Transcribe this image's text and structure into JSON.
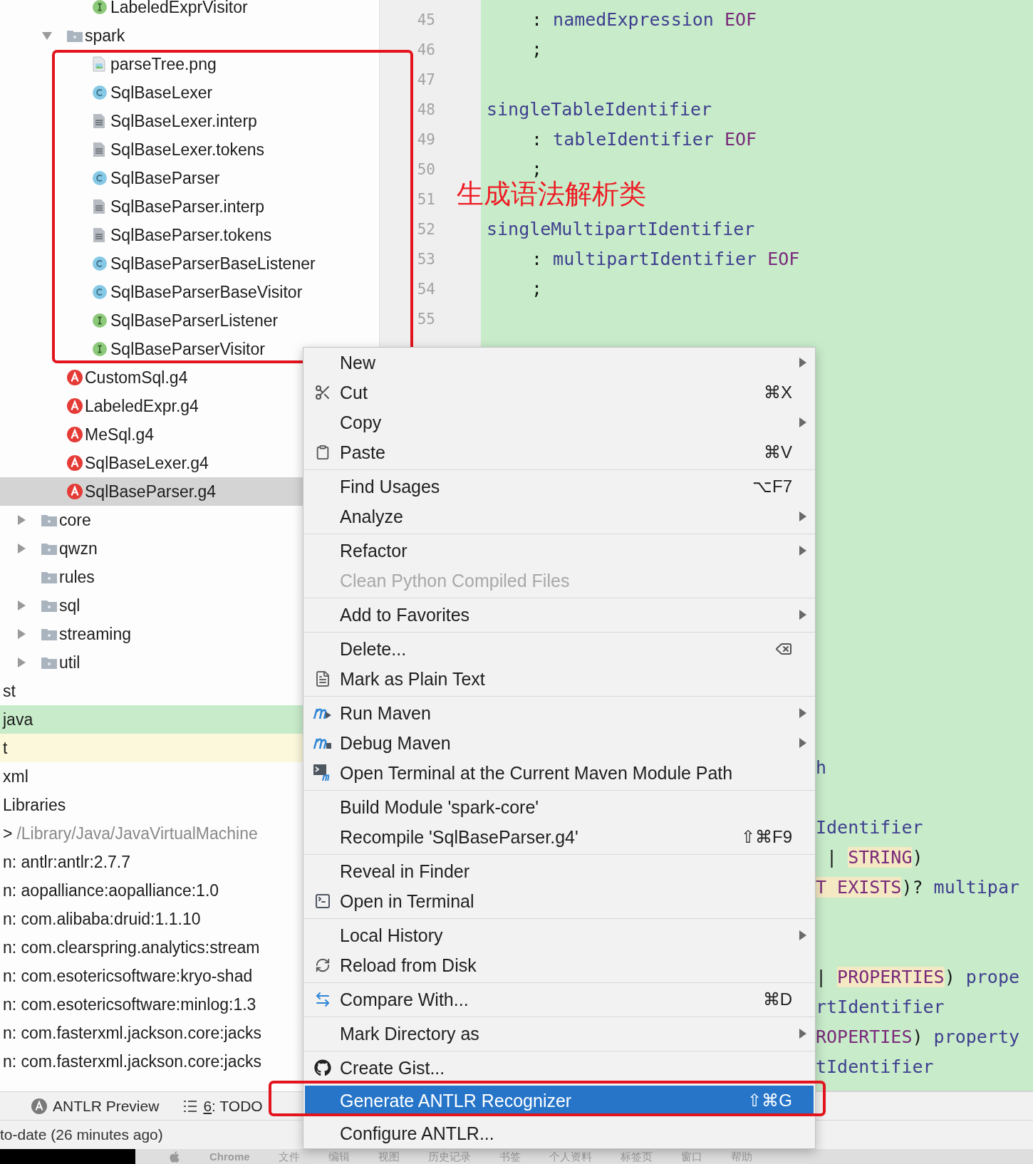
{
  "project_tree": [
    {
      "children": [
        {
          "children": [
            {
              "children": [
                {
                  "children": [
                    {
                      "label": "LabeledExprVisitor",
                      "kind": "interface",
                      "selected": false
                    }
                  ]
                },
                {
                  "label": "spark",
                  "kind": "folder",
                  "expanded": true,
                  "selected": false,
                  "children": [
                    {
                      "label": "parseTree.png",
                      "kind": "image",
                      "selected": false
                    },
                    {
                      "label": "SqlBaseLexer",
                      "kind": "class",
                      "selected": false
                    },
                    {
                      "label": "SqlBaseLexer.interp",
                      "kind": "file",
                      "selected": false
                    },
                    {
                      "label": "SqlBaseLexer.tokens",
                      "kind": "file",
                      "selected": false
                    },
                    {
                      "label": "SqlBaseParser",
                      "kind": "class",
                      "selected": false
                    },
                    {
                      "label": "SqlBaseParser.interp",
                      "kind": "file",
                      "selected": false
                    },
                    {
                      "label": "SqlBaseParser.tokens",
                      "kind": "file",
                      "selected": false
                    },
                    {
                      "label": "SqlBaseParserBaseListener",
                      "kind": "class",
                      "selected": false
                    },
                    {
                      "label": "SqlBaseParserBaseVisitor",
                      "kind": "class",
                      "selected": false
                    },
                    {
                      "label": "SqlBaseParserListener",
                      "kind": "interface",
                      "selected": false
                    },
                    {
                      "label": "SqlBaseParserVisitor",
                      "kind": "interface",
                      "selected": false
                    }
                  ]
                },
                {
                  "label": "CustomSql.g4",
                  "kind": "antlr",
                  "selected": false
                },
                {
                  "label": "LabeledExpr.g4",
                  "kind": "antlr",
                  "selected": false
                },
                {
                  "label": "MeSql.g4",
                  "kind": "antlr",
                  "selected": false
                },
                {
                  "label": "SqlBaseLexer.g4",
                  "kind": "antlr",
                  "selected": false
                },
                {
                  "label": "SqlBaseParser.g4",
                  "kind": "antlr",
                  "selected": true
                }
              ]
            },
            {
              "label": "core",
              "kind": "folder",
              "expanded": false,
              "selected": false
            },
            {
              "label": "qwzn",
              "kind": "folder",
              "expanded": false,
              "selected": false
            },
            {
              "label": "rules",
              "kind": "folder",
              "selected": false
            },
            {
              "label": "sql",
              "kind": "folder",
              "expanded": false,
              "selected": false
            },
            {
              "label": "streaming",
              "kind": "folder",
              "expanded": false,
              "selected": false
            },
            {
              "label": "util",
              "kind": "folder",
              "expanded": false,
              "selected": false
            }
          ]
        }
      ]
    },
    {
      "label": "st",
      "kind": "plain",
      "selected": false
    },
    {
      "label": "java",
      "kind": "plain",
      "color": "#c8ecca",
      "selected": false
    },
    {
      "label": "t",
      "kind": "plain",
      "color": "#fbf8dc",
      "selected": false
    },
    {
      "label": "xml",
      "kind": "plain",
      "selected": false
    },
    {
      "label": "Libraries",
      "kind": "plain",
      "selected": false
    },
    {
      "label": ">",
      "detail": "/Library/Java/JavaVirtualMachine",
      "kind": "plain",
      "selected": false
    },
    {
      "label": "n: antlr:antlr:2.7.7",
      "kind": "plain",
      "selected": false
    },
    {
      "label": "n: aopalliance:aopalliance:1.0",
      "kind": "plain",
      "selected": false
    },
    {
      "label": "n: com.alibaba:druid:1.1.10",
      "kind": "plain",
      "selected": false
    },
    {
      "label": "n: com.clearspring.analytics:stream",
      "kind": "plain",
      "selected": false
    },
    {
      "label": "n: com.esotericsoftware:kryo-shad",
      "kind": "plain",
      "selected": false
    },
    {
      "label": "n: com.esotericsoftware:minlog:1.3",
      "kind": "plain",
      "selected": false
    },
    {
      "label": "n: com.fasterxml.jackson.core:jacks",
      "kind": "plain",
      "selected": false
    },
    {
      "label": "n: com.fasterxml.jackson.core:jacks",
      "kind": "plain",
      "selected": false
    }
  ],
  "gutter": {
    "line_numbers": [
      "45",
      "46",
      "47",
      "48",
      "49",
      "50",
      "51",
      "52",
      "53",
      "54",
      "55"
    ]
  },
  "editor": {
    "lines": [
      {
        "kind": "code",
        "indent": true,
        "tokens": [
          {
            "text": ": ",
            "kind": "punct"
          },
          {
            "text": "namedExpression",
            "kind": "rule"
          },
          {
            "text": " EOF",
            "kind": "token"
          }
        ]
      },
      {
        "kind": "code",
        "indent": true,
        "tokens": [
          {
            "text": ";",
            "kind": "punct"
          }
        ]
      },
      {
        "kind": "blank"
      },
      {
        "kind": "code",
        "indent": false,
        "tokens": [
          {
            "text": "singleTableIdentifier",
            "kind": "rule"
          }
        ]
      },
      {
        "kind": "code",
        "indent": true,
        "tokens": [
          {
            "text": ": ",
            "kind": "punct"
          },
          {
            "text": "tableIdentifier",
            "kind": "rule"
          },
          {
            "text": " EOF",
            "kind": "token"
          }
        ]
      },
      {
        "kind": "code",
        "indent": true,
        "tokens": [
          {
            "text": ";",
            "kind": "punct"
          }
        ]
      },
      {
        "kind": "blank"
      },
      {
        "kind": "code",
        "indent": false,
        "tokens": [
          {
            "text": "singleMultipartIdentifier",
            "kind": "rule"
          }
        ]
      },
      {
        "kind": "code",
        "indent": true,
        "tokens": [
          {
            "text": ": ",
            "kind": "punct"
          },
          {
            "text": "multipartIdentifier",
            "kind": "rule"
          },
          {
            "text": " EOF",
            "kind": "token"
          }
        ]
      },
      {
        "kind": "code",
        "indent": true,
        "tokens": [
          {
            "text": ";",
            "kind": "punct"
          }
        ]
      },
      {
        "kind": "blank"
      },
      {
        "kind": "blank"
      },
      {
        "kind": "blank"
      },
      {
        "kind": "blank"
      },
      {
        "kind": "blank"
      },
      {
        "kind": "blank"
      },
      {
        "kind": "blank"
      },
      {
        "kind": "blank"
      },
      {
        "kind": "blank"
      },
      {
        "kind": "blank"
      },
      {
        "kind": "blank"
      },
      {
        "kind": "blank"
      },
      {
        "kind": "blank"
      },
      {
        "kind": "blank"
      },
      {
        "kind": "blank"
      },
      {
        "kind": "fragment",
        "tokens": [
          {
            "text": "h",
            "kind": "rule"
          }
        ]
      },
      {
        "kind": "blank"
      },
      {
        "kind": "fragment",
        "tokens": [
          {
            "text": "Identifier",
            "kind": "rule"
          }
        ]
      },
      {
        "kind": "fragment",
        "tokens": [
          {
            "text": " | ",
            "kind": "punct"
          },
          {
            "text": "STRING",
            "kind": "literal"
          },
          {
            "text": ")",
            "kind": "punct"
          }
        ]
      },
      {
        "kind": "fragment",
        "tokens": [
          {
            "text": "T EXISTS",
            "kind": "literal"
          },
          {
            "text": ")? ",
            "kind": "punct"
          },
          {
            "text": "multipar",
            "kind": "rule"
          }
        ]
      },
      {
        "kind": "blank"
      },
      {
        "kind": "blank"
      },
      {
        "kind": "fragment",
        "tokens": [
          {
            "text": "| ",
            "kind": "punct"
          },
          {
            "text": "PROPERTIES",
            "kind": "literal"
          },
          {
            "text": ") ",
            "kind": "punct"
          },
          {
            "text": "prope",
            "kind": "rule"
          }
        ]
      },
      {
        "kind": "fragment",
        "tokens": [
          {
            "text": "rtIdentifier",
            "kind": "rule"
          }
        ]
      },
      {
        "kind": "fragment",
        "tokens": [
          {
            "text": "ROPERTIES",
            "kind": "token"
          },
          {
            "text": ") ",
            "kind": "punct"
          },
          {
            "text": "property",
            "kind": "rule"
          }
        ]
      },
      {
        "kind": "fragment",
        "tokens": [
          {
            "text": "tIdentifier",
            "kind": "rule"
          }
        ]
      }
    ]
  },
  "annotation": {
    "text": "生成语法解析类"
  },
  "context_menu": {
    "groups": [
      [
        {
          "label": "New",
          "kind": "none",
          "submenu": true,
          "selected": false
        },
        {
          "label": "Cut",
          "kind": "cut",
          "shortcut": "⌘X",
          "selected": false
        },
        {
          "label": "Copy",
          "kind": "none",
          "submenu": true,
          "selected": false
        },
        {
          "label": "Paste",
          "kind": "paste",
          "shortcut": "⌘V",
          "selected": false
        }
      ],
      [
        {
          "label": "Find Usages",
          "kind": "none",
          "shortcut": "⌥F7",
          "selected": false
        },
        {
          "label": "Analyze",
          "kind": "none",
          "submenu": true,
          "selected": false
        }
      ],
      [
        {
          "label": "Refactor",
          "kind": "none",
          "submenu": true,
          "selected": false
        },
        {
          "label": "Clean Python Compiled Files",
          "kind": "none",
          "disabled": true,
          "selected": false
        }
      ],
      [
        {
          "label": "Add to Favorites",
          "kind": "none",
          "submenu": true,
          "selected": false
        }
      ],
      [
        {
          "label": "Delete...",
          "kind": "delete",
          "selected": false
        },
        {
          "label": "Mark as Plain Text",
          "kind": "plain-text",
          "selected": false
        }
      ],
      [
        {
          "label": "Run Maven",
          "kind": "maven-run",
          "submenu": true,
          "selected": false
        },
        {
          "label": "Debug Maven",
          "kind": "maven-debug",
          "submenu": true,
          "selected": false
        },
        {
          "label": "Open Terminal at the Current Maven Module Path",
          "kind": "maven-terminal",
          "selected": false
        }
      ],
      [
        {
          "label": "Build Module 'spark-core'",
          "kind": "none",
          "selected": false
        },
        {
          "label": "Recompile 'SqlBaseParser.g4'",
          "kind": "none",
          "shortcut": "⇧⌘F9",
          "selected": false
        }
      ],
      [
        {
          "label": "Reveal in Finder",
          "kind": "none",
          "selected": false
        },
        {
          "label": "Open in Terminal",
          "kind": "terminal",
          "selected": false
        }
      ],
      [
        {
          "label": "Local History",
          "kind": "none",
          "submenu": true,
          "selected": false
        },
        {
          "label": "Reload from Disk",
          "kind": "reload",
          "selected": false
        }
      ],
      [
        {
          "label": "Compare With...",
          "kind": "compare",
          "shortcut": "⌘D",
          "selected": false
        }
      ],
      [
        {
          "label": "Mark Directory as",
          "kind": "none",
          "submenu": true,
          "selected": false
        }
      ],
      [
        {
          "label": "Create Gist...",
          "kind": "github",
          "selected": false
        },
        {
          "label": "Generate ANTLR Recognizer",
          "kind": "none",
          "shortcut": "⇧⌘G",
          "selected": true
        },
        {
          "label": "Configure ANTLR...",
          "kind": "none",
          "selected": false
        }
      ]
    ]
  },
  "tool_window_bar": {
    "buttons": [
      {
        "label": "ANTLR Preview",
        "kind": "antlr"
      },
      {
        "label": ": TODO",
        "mnemonic": "6",
        "kind": "todo"
      }
    ]
  },
  "status_bar": {
    "text": "to-date (26 minutes ago)"
  },
  "mac_menu_bar": {
    "items": [
      "Chrome",
      "文件",
      "编辑",
      "视图",
      "历史记录",
      "书签",
      "个人资料",
      "标签页",
      "窗口",
      "帮助"
    ]
  }
}
